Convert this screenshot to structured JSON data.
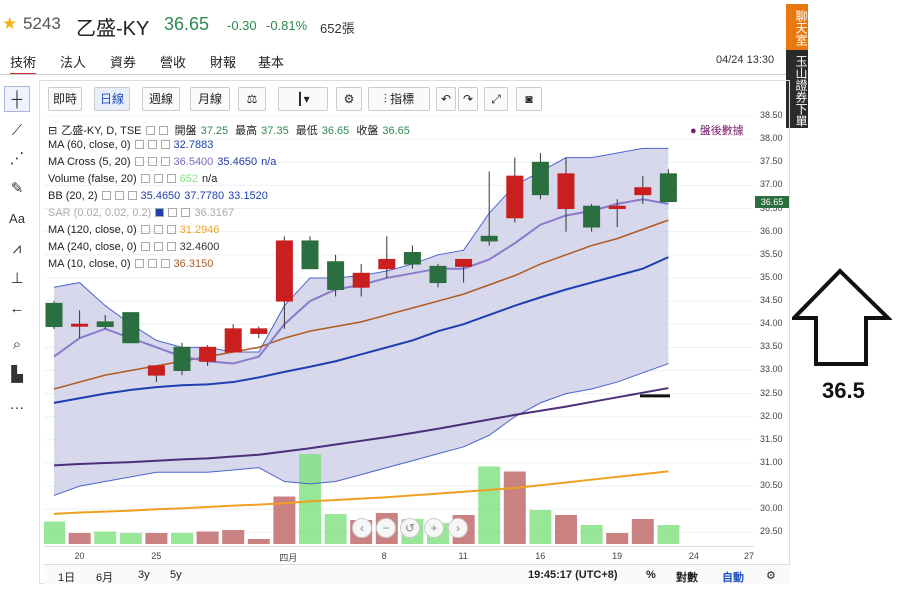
{
  "header": {
    "code": "5243",
    "name": "乙盛-KY",
    "price": "36.65",
    "change": "-0.30",
    "change_pct": "-0.81%",
    "volume": "652張",
    "datetime": "04/24 13:30"
  },
  "tabs": [
    "技術",
    "法人",
    "資券",
    "營收",
    "財報",
    "基本"
  ],
  "side_banner": {
    "top": "聊天室",
    "bottom": "玉山證券下單"
  },
  "toolbar": {
    "b1": "即時",
    "b2": "日線",
    "b3": "週線",
    "b4": "月線",
    "b5": "指標"
  },
  "legend": {
    "title": "乙盛-KY, D, TSE",
    "open_label": "開盤",
    "open": "37.25",
    "high_label": "最高",
    "high": "37.35",
    "low_label": "最低",
    "low": "36.65",
    "close_label": "收盤",
    "close": "36.65",
    "ma60": "MA (60, close, 0)",
    "ma60_v": "32.7883",
    "macross": "MA Cross (5, 20)",
    "macross_v1": "36.5400",
    "macross_v2": "35.4650",
    "macross_v3": "n/a",
    "vol": "Volume (false, 20)",
    "vol_v1": "652",
    "vol_v2": "n/a",
    "bb": "BB (20, 2)",
    "bb_v1": "35.4650",
    "bb_v2": "37.7780",
    "bb_v3": "33.1520",
    "sar": "SAR (0.02, 0.02, 0.2)",
    "sar_v": "36.3167",
    "ma120": "MA (120, close, 0)",
    "ma120_v": "31.2946",
    "ma240": "MA (240, close, 0)",
    "ma240_v": "32.4600",
    "ma10": "MA (10, close, 0)",
    "ma10_v": "36.3150",
    "after_hours": "盤後數據"
  },
  "yaxis": {
    "ticks": [
      "38.50",
      "38.00",
      "37.50",
      "37.00",
      "36.50",
      "36.00",
      "35.50",
      "35.00",
      "34.50",
      "34.00",
      "33.50",
      "33.00",
      "32.50",
      "32.00",
      "31.50",
      "31.00",
      "30.50",
      "30.00",
      "29.50"
    ],
    "last": "36.65"
  },
  "xaxis": {
    "ticks": [
      "20",
      "25",
      "四月",
      "8",
      "11",
      "16",
      "19",
      "24",
      "27"
    ]
  },
  "bottom": {
    "ranges": [
      "1日",
      "6月",
      "3y",
      "5y"
    ],
    "time": "19:45:17 (UTC+8)",
    "pct": "%",
    "log": "對數",
    "auto": "自動"
  },
  "annotation": "36.5",
  "chart_data": {
    "type": "candlestick",
    "ylim": [
      29.25,
      38.5
    ],
    "candles": [
      {
        "o": 34.45,
        "h": 34.5,
        "l": 33.9,
        "c": 33.95
      },
      {
        "o": 34.0,
        "h": 34.3,
        "l": 33.7,
        "c": 34.0
      },
      {
        "o": 34.05,
        "h": 34.2,
        "l": 33.9,
        "c": 33.95
      },
      {
        "o": 34.25,
        "h": 34.25,
        "l": 33.6,
        "c": 33.6
      },
      {
        "o": 32.9,
        "h": 33.1,
        "l": 32.75,
        "c": 33.1
      },
      {
        "o": 33.5,
        "h": 33.6,
        "l": 32.9,
        "c": 33.0
      },
      {
        "o": 33.2,
        "h": 33.55,
        "l": 33.1,
        "c": 33.5
      },
      {
        "o": 33.4,
        "h": 34.0,
        "l": 33.4,
        "c": 33.9
      },
      {
        "o": 33.8,
        "h": 33.95,
        "l": 33.7,
        "c": 33.9
      },
      {
        "o": 34.5,
        "h": 35.9,
        "l": 33.9,
        "c": 35.8
      },
      {
        "o": 35.8,
        "h": 35.9,
        "l": 35.2,
        "c": 35.2
      },
      {
        "o": 35.35,
        "h": 35.5,
        "l": 34.6,
        "c": 34.75
      },
      {
        "o": 34.8,
        "h": 35.3,
        "l": 34.6,
        "c": 35.1
      },
      {
        "o": 35.2,
        "h": 35.9,
        "l": 35.0,
        "c": 35.4
      },
      {
        "o": 35.55,
        "h": 35.7,
        "l": 35.2,
        "c": 35.3
      },
      {
        "o": 35.25,
        "h": 35.3,
        "l": 34.8,
        "c": 34.9
      },
      {
        "o": 35.25,
        "h": 35.4,
        "l": 34.9,
        "c": 35.4
      },
      {
        "o": 35.9,
        "h": 37.3,
        "l": 35.7,
        "c": 35.8
      },
      {
        "o": 36.3,
        "h": 37.6,
        "l": 36.2,
        "c": 37.2
      },
      {
        "o": 37.5,
        "h": 37.7,
        "l": 36.7,
        "c": 36.8
      },
      {
        "o": 36.5,
        "h": 37.6,
        "l": 36.0,
        "c": 37.25
      },
      {
        "o": 36.55,
        "h": 36.6,
        "l": 36.0,
        "c": 36.1
      },
      {
        "o": 36.5,
        "h": 36.7,
        "l": 36.1,
        "c": 36.55
      },
      {
        "o": 36.8,
        "h": 37.2,
        "l": 36.6,
        "c": 36.95
      },
      {
        "o": 37.25,
        "h": 37.35,
        "l": 36.65,
        "c": 36.65
      }
    ],
    "volume": [
      45,
      22,
      25,
      22,
      22,
      22,
      25,
      28,
      10,
      95,
      180,
      60,
      48,
      62,
      50,
      42,
      58,
      155,
      145,
      68,
      58,
      38,
      22,
      50,
      38
    ],
    "bb_upper": [
      34.8,
      34.9,
      34.4,
      34.0,
      33.65,
      33.5,
      33.5,
      33.4,
      33.4,
      34.4,
      35.0,
      35.0,
      35.05,
      35.15,
      35.3,
      35.5,
      35.6,
      36.4,
      37.0,
      37.3,
      37.6,
      37.6,
      37.7,
      37.8,
      37.8
    ],
    "bb_lower": [
      30.3,
      30.5,
      30.6,
      30.7,
      30.8,
      30.8,
      30.8,
      30.85,
      30.9,
      30.6,
      30.55,
      30.6,
      30.75,
      30.9,
      31.05,
      31.2,
      31.35,
      31.6,
      32.0,
      32.3,
      32.5,
      32.6,
      32.75,
      32.95,
      33.15
    ],
    "ma_purple": [
      33.3,
      33.7,
      33.9,
      33.7,
      33.5,
      33.3,
      33.2,
      33.15,
      33.3,
      34.0,
      34.5,
      34.75,
      34.85,
      35.0,
      35.1,
      35.2,
      35.2,
      35.4,
      35.75,
      36.15,
      36.35,
      36.45,
      36.6,
      36.7,
      36.6
    ],
    "ma_brown": [
      32.6,
      32.75,
      32.9,
      33.0,
      33.1,
      33.2,
      33.3,
      33.4,
      33.5,
      33.7,
      33.85,
      33.95,
      34.05,
      34.2,
      34.35,
      34.5,
      34.65,
      34.85,
      35.05,
      35.3,
      35.5,
      35.7,
      35.85,
      36.05,
      36.25
    ],
    "ma_blue": [
      32.3,
      32.4,
      32.5,
      32.58,
      32.64,
      32.68,
      32.7,
      32.75,
      32.85,
      32.97,
      33.08,
      33.2,
      33.35,
      33.5,
      33.65,
      33.85,
      34.0,
      34.2,
      34.4,
      34.58,
      34.75,
      34.9,
      35.05,
      35.2,
      35.45
    ],
    "ma_indigo": [
      30.95,
      30.98,
      31.0,
      31.02,
      31.05,
      31.08,
      31.1,
      31.14,
      31.18,
      31.25,
      31.32,
      31.4,
      31.48,
      31.56,
      31.65,
      31.74,
      31.84,
      31.94,
      32.04,
      32.13,
      32.22,
      32.32,
      32.42,
      32.52,
      32.62
    ],
    "ma_orange": [
      29.9,
      29.93,
      29.95,
      29.97,
      30.0,
      30.02,
      30.05,
      30.08,
      30.1,
      30.13,
      30.17,
      30.2,
      30.23,
      30.26,
      30.3,
      30.34,
      30.38,
      30.42,
      30.46,
      30.52,
      30.58,
      30.64,
      30.7,
      30.76,
      30.82
    ]
  }
}
